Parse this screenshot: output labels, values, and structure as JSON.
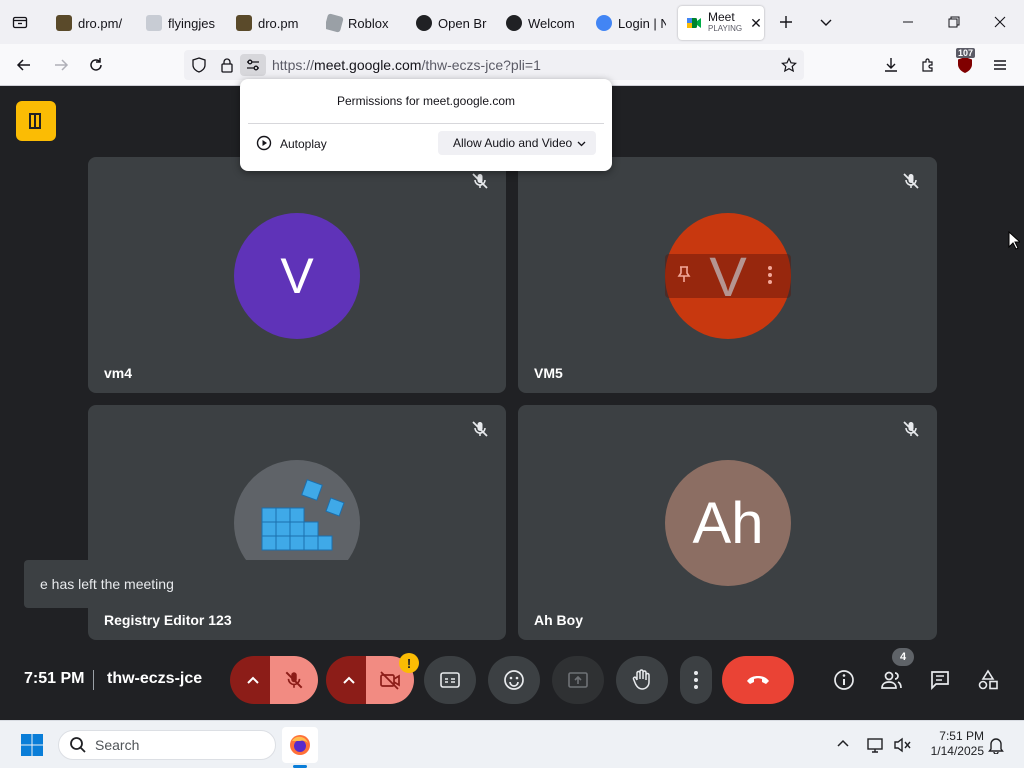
{
  "tabs": [
    {
      "label": "dro.pm/",
      "fav_color": "#5a4a2a"
    },
    {
      "label": "flyingjes",
      "fav_color": "#c8ccd4"
    },
    {
      "label": "dro.pm",
      "fav_color": "#5a4a2a"
    },
    {
      "label": "Roblox",
      "fav_color": "#9aa0a6"
    },
    {
      "label": "Open Br",
      "fav_color": "#202124"
    },
    {
      "label": "Welcom",
      "fav_color": "#202124"
    },
    {
      "label": "Login | N",
      "fav_color": "#4285f4"
    },
    {
      "label": "Meet",
      "sublabel": "PLAYING",
      "fav_color": "#00832d"
    }
  ],
  "address": {
    "prefix": "https://",
    "host": "meet.google.com",
    "path": "/thw-eczs-jce?pli=1"
  },
  "extension_badge": "107",
  "permissions": {
    "title": "Permissions for meet.google.com",
    "autoplay_label": "Autoplay",
    "autoplay_value": "Allow Audio and Video"
  },
  "participants": [
    {
      "name": "vm4",
      "initial": "V",
      "color": "#5f33b8"
    },
    {
      "name": "VM5",
      "initial": "V",
      "color": "#c8380f"
    },
    {
      "name": "Registry Editor 123",
      "initial": "",
      "color": "#5f6368"
    },
    {
      "name": "Ah Boy",
      "initial": "Ah",
      "color": "#8c6e63"
    }
  ],
  "toast": "e has left the meeting",
  "meeting": {
    "time": "7:51 PM",
    "code": "thw-eczs-jce",
    "people_count": "4",
    "camera_warning": "!"
  },
  "colors": {
    "end_call": "#ea4335",
    "mute_bg": "#f28b82",
    "arrow_bg": "#8c1d18",
    "logo": "#fbbc04"
  },
  "taskbar": {
    "search_placeholder": "Search",
    "time": "7:51 PM",
    "date": "1/14/2025"
  }
}
